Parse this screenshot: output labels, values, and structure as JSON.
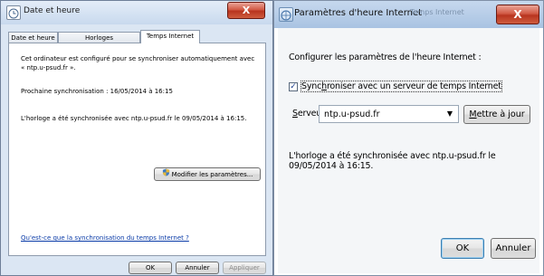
{
  "left_window": {
    "title": "Date et heure",
    "close_label": "X",
    "tabs": [
      {
        "label": "Date et heure"
      },
      {
        "label": "Horloges supplémentaires"
      },
      {
        "label": "Temps Internet"
      }
    ],
    "info_line1": "Cet ordinateur est configuré pour se synchroniser automatiquement avec",
    "info_line2": "« ntp.u-psud.fr ».",
    "next_sync": "Prochaine synchronisation : 16/05/2014 à 16:15",
    "last_sync": "L'horloge a été synchronisée avec ntp.u-psud.fr le 09/05/2014 à 16:15.",
    "modify_button": "Modifier les paramètres...",
    "help_link": "Qu'est-ce que la synchronisation du temps Internet ?",
    "ok_button": "OK",
    "cancel_button": "Annuler",
    "apply_button": "Appliquer"
  },
  "right_window": {
    "title": "Paramètres d'heure Internet",
    "ghost_title": "Temps Internet",
    "close_label": "X",
    "heading": "Configurer les paramètres de l'heure Internet :",
    "sync_checkbox_checked": true,
    "sync_checkbox_label": "Synchroniser avec un serveur de temps Internet",
    "server_label": "Serveur :",
    "server_value": "ntp.u-psud.fr",
    "update_button": "Mettre à jour",
    "status_text": "L'horloge a été synchronisée avec ntp.u-psud.fr le 09/05/2014 à 16:15.",
    "ok_button": "OK",
    "cancel_button": "Annuler"
  },
  "colors": {
    "close_button": "#c8462f",
    "link": "#0b3ca8",
    "titlebar": "#c8d9ee"
  },
  "icons": {
    "left_title": "clock-icon",
    "right_title": "globe-clock-icon",
    "modify": "shield-icon",
    "dropdown": "chevron-down-icon"
  }
}
